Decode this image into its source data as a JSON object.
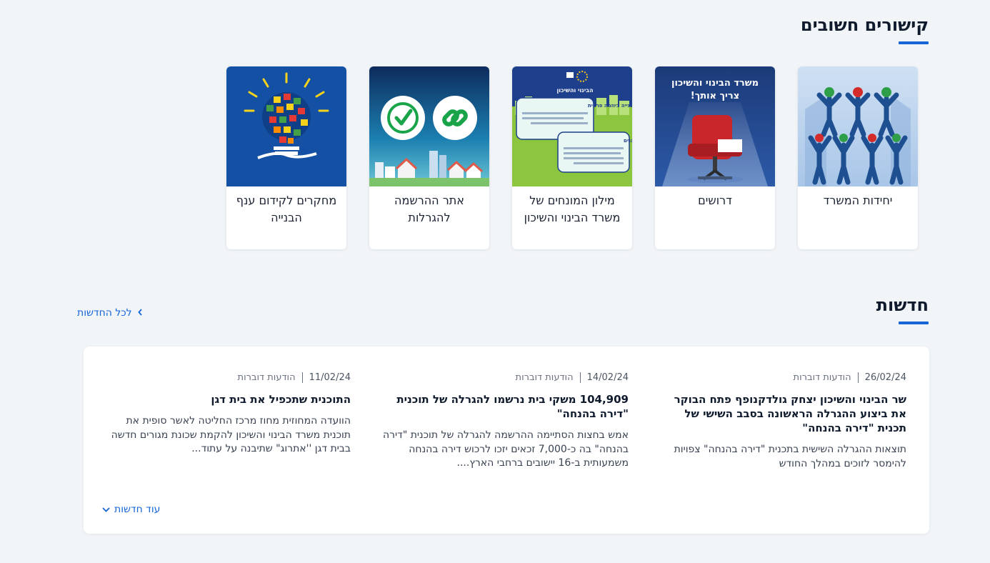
{
  "links": {
    "title": "קישורים חשובים",
    "cards": [
      {
        "label": "יחידות המשרד",
        "image": "people-group-illustration"
      },
      {
        "label": "דרושים",
        "image": "empty-chair-spotlight-illustration",
        "image_text": "משרד הבינוי והשיכון צריך אותך!"
      },
      {
        "label": "מילון המונחים של משרד הבינוי והשיכון",
        "image": "glossary-speech-bubbles-illustration",
        "image_text": [
          "הבינוי והשיכון",
          "בנייה ביוזמה פרטית",
          "דירות מוגנים"
        ]
      },
      {
        "label": "אתר ההרשמה להגרלות",
        "image": "link-and-checkmark-icons-city-illustration"
      },
      {
        "label": "מחקרים לקידום ענף הבנייה",
        "image": "lightbulb-houses-illustration"
      }
    ]
  },
  "news": {
    "title": "חדשות",
    "all_link": "לכל החדשות",
    "more_label": "עוד חדשות",
    "items": [
      {
        "date": "26/02/24",
        "category": "הודעות דוברות",
        "title": "שר הבינוי והשיכון יצחק גולדקנופף פתח הבוקר את ביצוע ההגרלה הראשונה בסבב השישי של תכנית \"דירה בהנחה\"",
        "body": "תוצאות ההגרלה השישית בתכנית \"דירה בהנחה\" צפויות להימסר לזוכים במהלך החודש"
      },
      {
        "date": "14/02/24",
        "category": "הודעות דוברות",
        "title": "104,909 משקי בית נרשמו להגרלה של תוכנית \"דירה בהנחה\"",
        "body": "אמש בחצות הסתיימה ההרשמה להגרלה של תוכנית \"דירה בהנחה\" בה כ-7,000 זכאים יזכו לרכוש דירה בהנחה משמעותית ב-16 יישובים ברחבי הארץ...."
      },
      {
        "date": "11/02/24",
        "category": "הודעות דוברות",
        "title": "התוכנית שתכפיל את בית דגן",
        "body": "הוועדה המחוזית מחוז מרכז החליטה לאשר סופית את תוכנית משרד הבינוי והשיכון להקמת שכונת מגורים חדשה בבית דגן ''אתרוג\" שתיבנה על עתוד..."
      }
    ]
  },
  "colors": {
    "accent": "#1565d8",
    "background": "#f2f5f8",
    "title": "#0f1b2d"
  }
}
